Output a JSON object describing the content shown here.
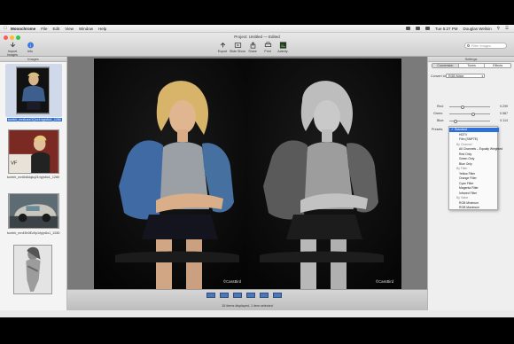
{
  "menubar": {
    "items": [
      "Monochrome",
      "File",
      "Edit",
      "View",
      "Window",
      "Help"
    ],
    "time": "Tue 5:27 PM",
    "user": "Douglas Wellsin"
  },
  "toolbar": {
    "project_title": "Project: Untitled — Edited",
    "import_label": "Import Images",
    "info_label": "Info",
    "export_label": "Export",
    "slideshow_label": "Slide Show",
    "share_label": "Share",
    "print_label": "Print",
    "activity_label": "Activity",
    "search_placeholder": "Filter Images"
  },
  "sidebar": {
    "title": "Images",
    "thumbnails": [
      {
        "label": "tumblr_mn6uxzOQvz1rlpjn8o1_1280",
        "selected": true
      },
      {
        "label": "tumblr_mn6b8dqkq21rlpjn8o1_1280",
        "selected": false
      },
      {
        "label": "tumblr_mn45h0Ez0p1rlpjn8o1_1280",
        "selected": false
      },
      {
        "label": "",
        "selected": false
      }
    ]
  },
  "main": {
    "credit_left": "©CassBird",
    "credit_right": "©CassBird",
    "status": "15 Items displayed, 1 item selected"
  },
  "settings": {
    "title": "Settings",
    "tabs": [
      "Conversion",
      "Tones",
      "Effects"
    ],
    "active_tab": "Conversion",
    "convert_label": "Convert Using:",
    "convert_value": "RGB Mixer",
    "red_label": "Red:",
    "red_value": "0.299",
    "red_fraction": 0.299,
    "green_label": "Green:",
    "green_value": "0.587",
    "green_fraction": 0.587,
    "blue_label": "Blue:",
    "blue_value": "0.114",
    "blue_fraction": 0.114,
    "presets_label": "Presets:"
  },
  "dropdown": {
    "options": [
      {
        "label": "Standard",
        "type": "selected"
      },
      {
        "label": "HDTV",
        "type": "option"
      },
      {
        "label": "Film (SMPTE)",
        "type": "option"
      },
      {
        "label": "By Channel",
        "type": "header"
      },
      {
        "label": "All Channels – Equally Weighted",
        "type": "option"
      },
      {
        "label": "Red Only",
        "type": "option"
      },
      {
        "label": "Green Only",
        "type": "option"
      },
      {
        "label": "Blue Only",
        "type": "option"
      },
      {
        "label": "By Filter",
        "type": "header"
      },
      {
        "label": "Yellow Filter",
        "type": "option"
      },
      {
        "label": "Orange Filter",
        "type": "option"
      },
      {
        "label": "Cyan Filter",
        "type": "option"
      },
      {
        "label": "Magenta Filter",
        "type": "option"
      },
      {
        "label": "Infrared Filter",
        "type": "option"
      },
      {
        "label": "By Value",
        "type": "header"
      },
      {
        "label": "RGB Minimum",
        "type": "option"
      },
      {
        "label": "RGB Maximum",
        "type": "option"
      }
    ]
  },
  "colors": {
    "accent": "#2f6fd6",
    "panel": "#efefef",
    "canvas": "#7a7a7a"
  }
}
